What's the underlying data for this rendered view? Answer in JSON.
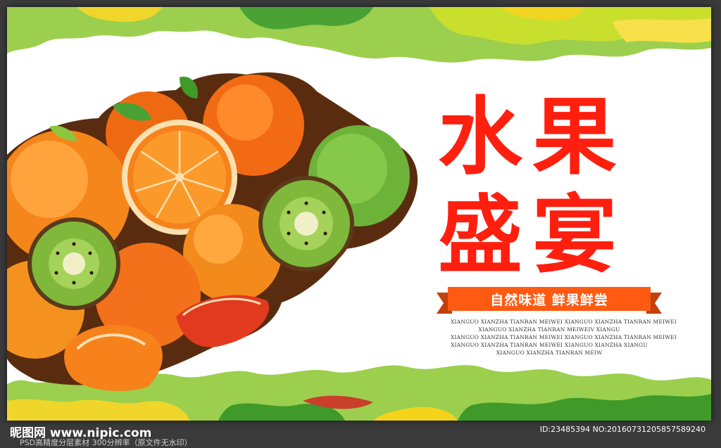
{
  "title": {
    "line1": "水果",
    "line2": "盛宴",
    "color": "#ff1f0f"
  },
  "ribbon": {
    "text": "自然味道 鲜果鲜尝",
    "color": "#ff5a12",
    "fold_color": "#c2400b"
  },
  "pinyin_lines": [
    "XIANGUO XIANZHA TIANRAN MEIWEI XIANGUO XIANZHA TIANRAN MEIWEI",
    "XIANGUO XIANZHA TIANRAN MEIWEIV XIANGU",
    "XIANGUO XIANZHA TIANRAN MEIWEI XIANGUO XIANZHA TIANRAN MEIWEI",
    "XIANGUO XIANZHA TIANRAN MEIWEI XIANGUO XIANZHA XIANGU",
    "XIANGUO XIANZHA TIANRAN MEIW"
  ],
  "watermark": {
    "site": "昵图网 www.nipic.com",
    "id": "ID:23485394 NO:20160731205857589240",
    "sub": "PSD高精度分层素材 300分辨率（原文件无水印）"
  },
  "colors": {
    "leaf_green": "#8cc63f",
    "dark_green": "#3f9a2a",
    "yellow": "#f5d31a",
    "orange": "#f7821b",
    "kiwi_green": "#7fb83a"
  }
}
